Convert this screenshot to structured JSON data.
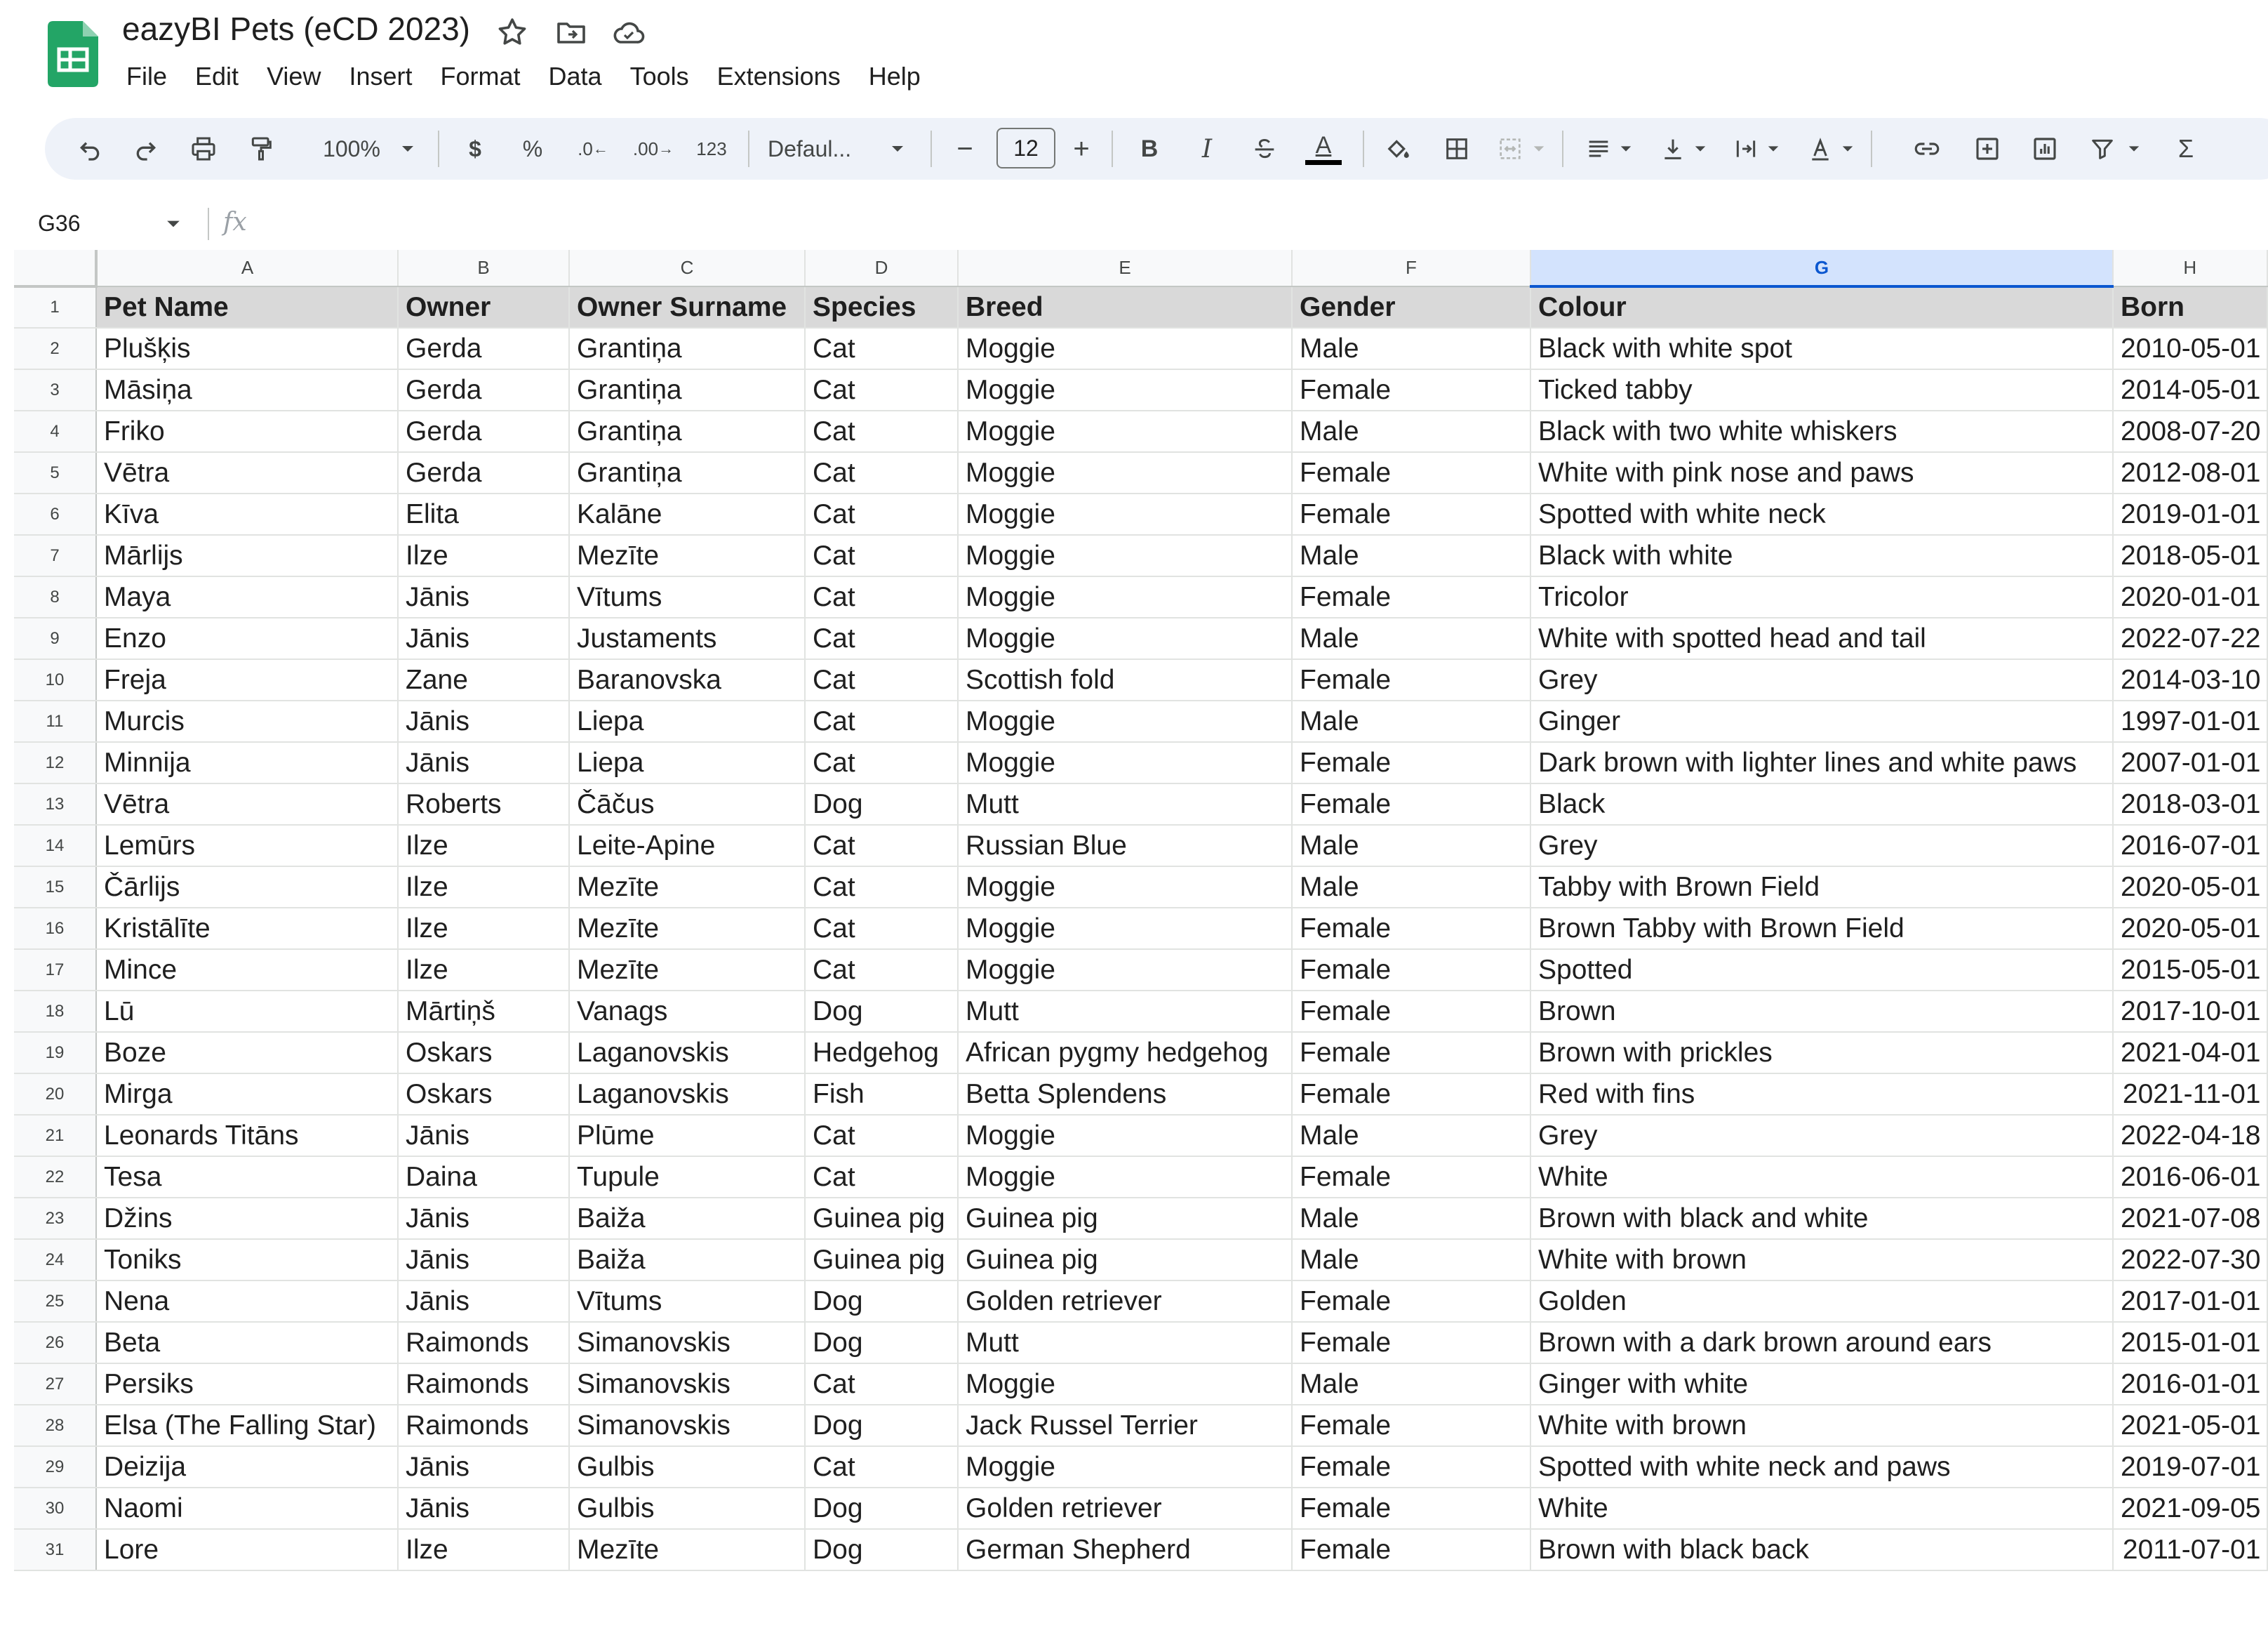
{
  "app": {
    "logo_icon": "google-sheets-icon",
    "title": "eazyBI Pets (eCD 2023)",
    "title_icons": [
      "star-icon",
      "move-to-folder-icon",
      "cloud-status-icon"
    ]
  },
  "menu": [
    "File",
    "Edit",
    "View",
    "Insert",
    "Format",
    "Data",
    "Tools",
    "Extensions",
    "Help"
  ],
  "toolbar": {
    "zoom": "100%",
    "currency": "$",
    "percent": "%",
    "decrease_decimal": ".0",
    "increase_decimal": ".00",
    "number_format": "123",
    "font": "Defaul...",
    "font_size": "12",
    "minus": "−",
    "plus": "+",
    "bold": "B",
    "italic": "I",
    "text_color": "A",
    "sum": "Σ",
    "accent_color": "#0b57d0",
    "toolbar_bg": "#eef2f9"
  },
  "formula_bar": {
    "cell_ref": "G36",
    "fx": "fx",
    "formula": ""
  },
  "grid": {
    "selected_column": "G",
    "columns": [
      "A",
      "B",
      "C",
      "D",
      "E",
      "F",
      "G",
      "H"
    ],
    "header": [
      "Pet Name",
      "Owner",
      "Owner Surname",
      "Species",
      "Breed",
      "Gender",
      "Colour",
      "Born"
    ],
    "rows": [
      [
        "Plušķis",
        "Gerda",
        "Grantiņa",
        "Cat",
        "Moggie",
        "Male",
        "Black with white spot",
        "2010-05-01"
      ],
      [
        "Māsiņa",
        "Gerda",
        "Grantiņa",
        "Cat",
        "Moggie",
        "Female",
        "Ticked tabby",
        "2014-05-01"
      ],
      [
        "Friko",
        "Gerda",
        "Grantiņa",
        "Cat",
        "Moggie",
        "Male",
        "Black with two white whiskers",
        "2008-07-20"
      ],
      [
        "Vētra",
        "Gerda",
        "Grantiņa",
        "Cat",
        "Moggie",
        "Female",
        "White with pink nose and paws",
        "2012-08-01"
      ],
      [
        "Kīva",
        "Elita",
        "Kalāne",
        "Cat",
        "Moggie",
        "Female",
        "Spotted with white neck",
        "2019-01-01"
      ],
      [
        "Mārlijs",
        "Ilze",
        "Mezīte",
        "Cat",
        "Moggie",
        "Male",
        "Black with white",
        "2018-05-01"
      ],
      [
        "Maya",
        "Jānis",
        "Vītums",
        "Cat",
        "Moggie",
        "Female",
        "Tricolor",
        "2020-01-01"
      ],
      [
        "Enzo",
        "Jānis",
        "Justaments",
        "Cat",
        "Moggie",
        "Male",
        "White with spotted head and tail",
        "2022-07-22"
      ],
      [
        "Freja",
        "Zane",
        "Baranovska",
        "Cat",
        "Scottish fold",
        "Female",
        "Grey",
        "2014-03-10"
      ],
      [
        "Murcis",
        "Jānis",
        "Liepa",
        "Cat",
        "Moggie",
        "Male",
        "Ginger",
        "1997-01-01"
      ],
      [
        "Minnija",
        "Jānis",
        "Liepa",
        "Cat",
        "Moggie",
        "Female",
        "Dark brown with lighter lines and white paws",
        "2007-01-01"
      ],
      [
        "Vētra",
        "Roberts",
        "Čāčus",
        "Dog",
        "Mutt",
        "Female",
        "Black",
        "2018-03-01"
      ],
      [
        "Lemūrs",
        "Ilze",
        "Leite-Apine",
        "Cat",
        "Russian Blue",
        "Male",
        "Grey",
        "2016-07-01"
      ],
      [
        "Čārlijs",
        "Ilze",
        "Mezīte",
        "Cat",
        "Moggie",
        "Male",
        "Tabby with Brown Field",
        "2020-05-01"
      ],
      [
        "Kristālīte",
        "Ilze",
        "Mezīte",
        "Cat",
        "Moggie",
        "Female",
        "Brown Tabby with Brown Field",
        "2020-05-01"
      ],
      [
        "Mince",
        "Ilze",
        "Mezīte",
        "Cat",
        "Moggie",
        "Female",
        "Spotted",
        "2015-05-01"
      ],
      [
        "Lū",
        "Mārtiņš",
        "Vanags",
        "Dog",
        "Mutt",
        "Female",
        "Brown",
        "2017-10-01"
      ],
      [
        "Boze",
        "Oskars",
        "Laganovskis",
        "Hedgehog",
        "African pygmy hedgehog",
        "Female",
        "Brown with prickles",
        "2021-04-01"
      ],
      [
        "Mirga",
        "Oskars",
        "Laganovskis",
        "Fish",
        "Betta Splendens",
        "Female",
        "Red with fins",
        "2021-11-01"
      ],
      [
        "Leonards Titāns",
        "Jānis",
        "Plūme",
        "Cat",
        "Moggie",
        "Male",
        "Grey",
        "2022-04-18"
      ],
      [
        "Tesa",
        "Daina",
        "Tupule",
        "Cat",
        "Moggie",
        "Female",
        "White",
        "2016-06-01"
      ],
      [
        "Džins",
        "Jānis",
        "Baiža",
        "Guinea pig",
        "Guinea pig",
        "Male",
        "Brown with black and white",
        "2021-07-08"
      ],
      [
        "Toniks",
        "Jānis",
        "Baiža",
        "Guinea pig",
        "Guinea pig",
        "Male",
        "White with brown",
        "2022-07-30"
      ],
      [
        "Nena",
        "Jānis",
        "Vītums",
        "Dog",
        "Golden retriever",
        "Female",
        "Golden",
        "2017-01-01"
      ],
      [
        "Beta",
        "Raimonds",
        "Simanovskis",
        "Dog",
        "Mutt",
        "Female",
        "Brown with a dark brown  around ears",
        "2015-01-01"
      ],
      [
        "Persiks",
        "Raimonds",
        "Simanovskis",
        "Cat",
        "Moggie",
        "Male",
        "Ginger with white",
        "2016-01-01"
      ],
      [
        "Elsa (The Falling Star)",
        "Raimonds",
        "Simanovskis",
        "Dog",
        "Jack Russel Terrier",
        "Female",
        "White with brown",
        "2021-05-01"
      ],
      [
        "Deizija",
        "Jānis",
        "Gulbis",
        "Cat",
        "Moggie",
        "Female",
        "Spotted with white neck and paws",
        "2019-07-01"
      ],
      [
        "Naomi",
        "Jānis",
        "Gulbis",
        "Dog",
        "Golden retriever",
        "Female",
        "White",
        "2021-09-05"
      ],
      [
        "Lore",
        "Ilze",
        "Mezīte",
        "Dog",
        "German Shepherd",
        "Female",
        "Brown with black back",
        "2011-07-01"
      ]
    ]
  }
}
